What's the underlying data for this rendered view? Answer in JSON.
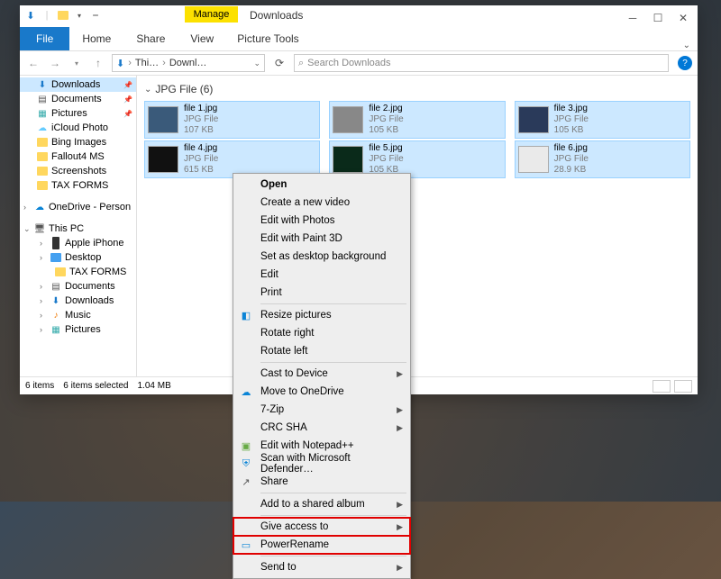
{
  "window": {
    "title": "Downloads"
  },
  "ribbon": {
    "pictureTools": {
      "label": "Manage",
      "sub": "Picture Tools"
    },
    "file": "File",
    "tabs": [
      "Home",
      "Share",
      "View"
    ]
  },
  "breadcrumb": {
    "items": [
      "Thi…",
      "Downl…"
    ]
  },
  "search": {
    "placeholder": "Search Downloads"
  },
  "sidebar": {
    "quick": [
      {
        "label": "Downloads",
        "icon": "download",
        "pinned": true,
        "active": true
      },
      {
        "label": "Documents",
        "icon": "doc",
        "pinned": true
      },
      {
        "label": "Pictures",
        "icon": "pic",
        "pinned": true
      },
      {
        "label": "iCloud Photo",
        "icon": "icloud"
      },
      {
        "label": "Bing Images",
        "icon": "folder"
      },
      {
        "label": "Fallout4 MS",
        "icon": "folder"
      },
      {
        "label": "Screenshots",
        "icon": "folder"
      },
      {
        "label": "TAX FORMS",
        "icon": "folder"
      }
    ],
    "onedrive": {
      "label": "OneDrive - Person"
    },
    "thispc": {
      "label": "This PC",
      "children": [
        {
          "label": "Apple iPhone",
          "icon": "phone"
        },
        {
          "label": "Desktop",
          "icon": "folder-blue"
        },
        {
          "label": "TAX FORMS",
          "icon": "folder",
          "indent": true
        },
        {
          "label": "Documents",
          "icon": "doc"
        },
        {
          "label": "Downloads",
          "icon": "download"
        },
        {
          "label": "Music",
          "icon": "music"
        },
        {
          "label": "Pictures",
          "icon": "pic"
        }
      ]
    }
  },
  "group": {
    "header": "JPG File (6)"
  },
  "files": [
    {
      "name": "file 1.jpg",
      "type": "JPG File",
      "size": "107 KB"
    },
    {
      "name": "file 2.jpg",
      "type": "JPG File",
      "size": "105 KB"
    },
    {
      "name": "file 3.jpg",
      "type": "JPG File",
      "size": "105 KB"
    },
    {
      "name": "file 4.jpg",
      "type": "JPG File",
      "size": "615 KB"
    },
    {
      "name": "file 5.jpg",
      "type": "JPG File",
      "size": "105 KB"
    },
    {
      "name": "file 6.jpg",
      "type": "JPG File",
      "size": "28.9 KB"
    }
  ],
  "status": {
    "items": "6 items",
    "selected": "6 items selected",
    "size": "1.04 MB"
  },
  "contextMenu": {
    "items": [
      {
        "label": "Open",
        "bold": true
      },
      {
        "label": "Create a new video"
      },
      {
        "label": "Edit with Photos"
      },
      {
        "label": "Edit with Paint 3D"
      },
      {
        "label": "Set as desktop background"
      },
      {
        "label": "Edit"
      },
      {
        "label": "Print"
      },
      {
        "sep": true
      },
      {
        "label": "Resize pictures",
        "icon": "resize"
      },
      {
        "label": "Rotate right"
      },
      {
        "label": "Rotate left"
      },
      {
        "sep": true
      },
      {
        "label": "Cast to Device",
        "submenu": true
      },
      {
        "label": "Move to OneDrive",
        "icon": "onedrive"
      },
      {
        "label": "7-Zip",
        "submenu": true
      },
      {
        "label": "CRC SHA",
        "submenu": true
      },
      {
        "label": "Edit with Notepad++",
        "icon": "npp"
      },
      {
        "label": "Scan with Microsoft Defender…",
        "icon": "shield"
      },
      {
        "label": "Share",
        "icon": "share"
      },
      {
        "sep": true
      },
      {
        "label": "Add to a shared album",
        "submenu": true
      },
      {
        "sep": true
      },
      {
        "label": "Give access to",
        "submenu": true,
        "highlight": true
      },
      {
        "label": "PowerRename",
        "icon": "rename",
        "highlight": true
      },
      {
        "sep": true
      },
      {
        "label": "Send to",
        "submenu": true
      }
    ]
  }
}
